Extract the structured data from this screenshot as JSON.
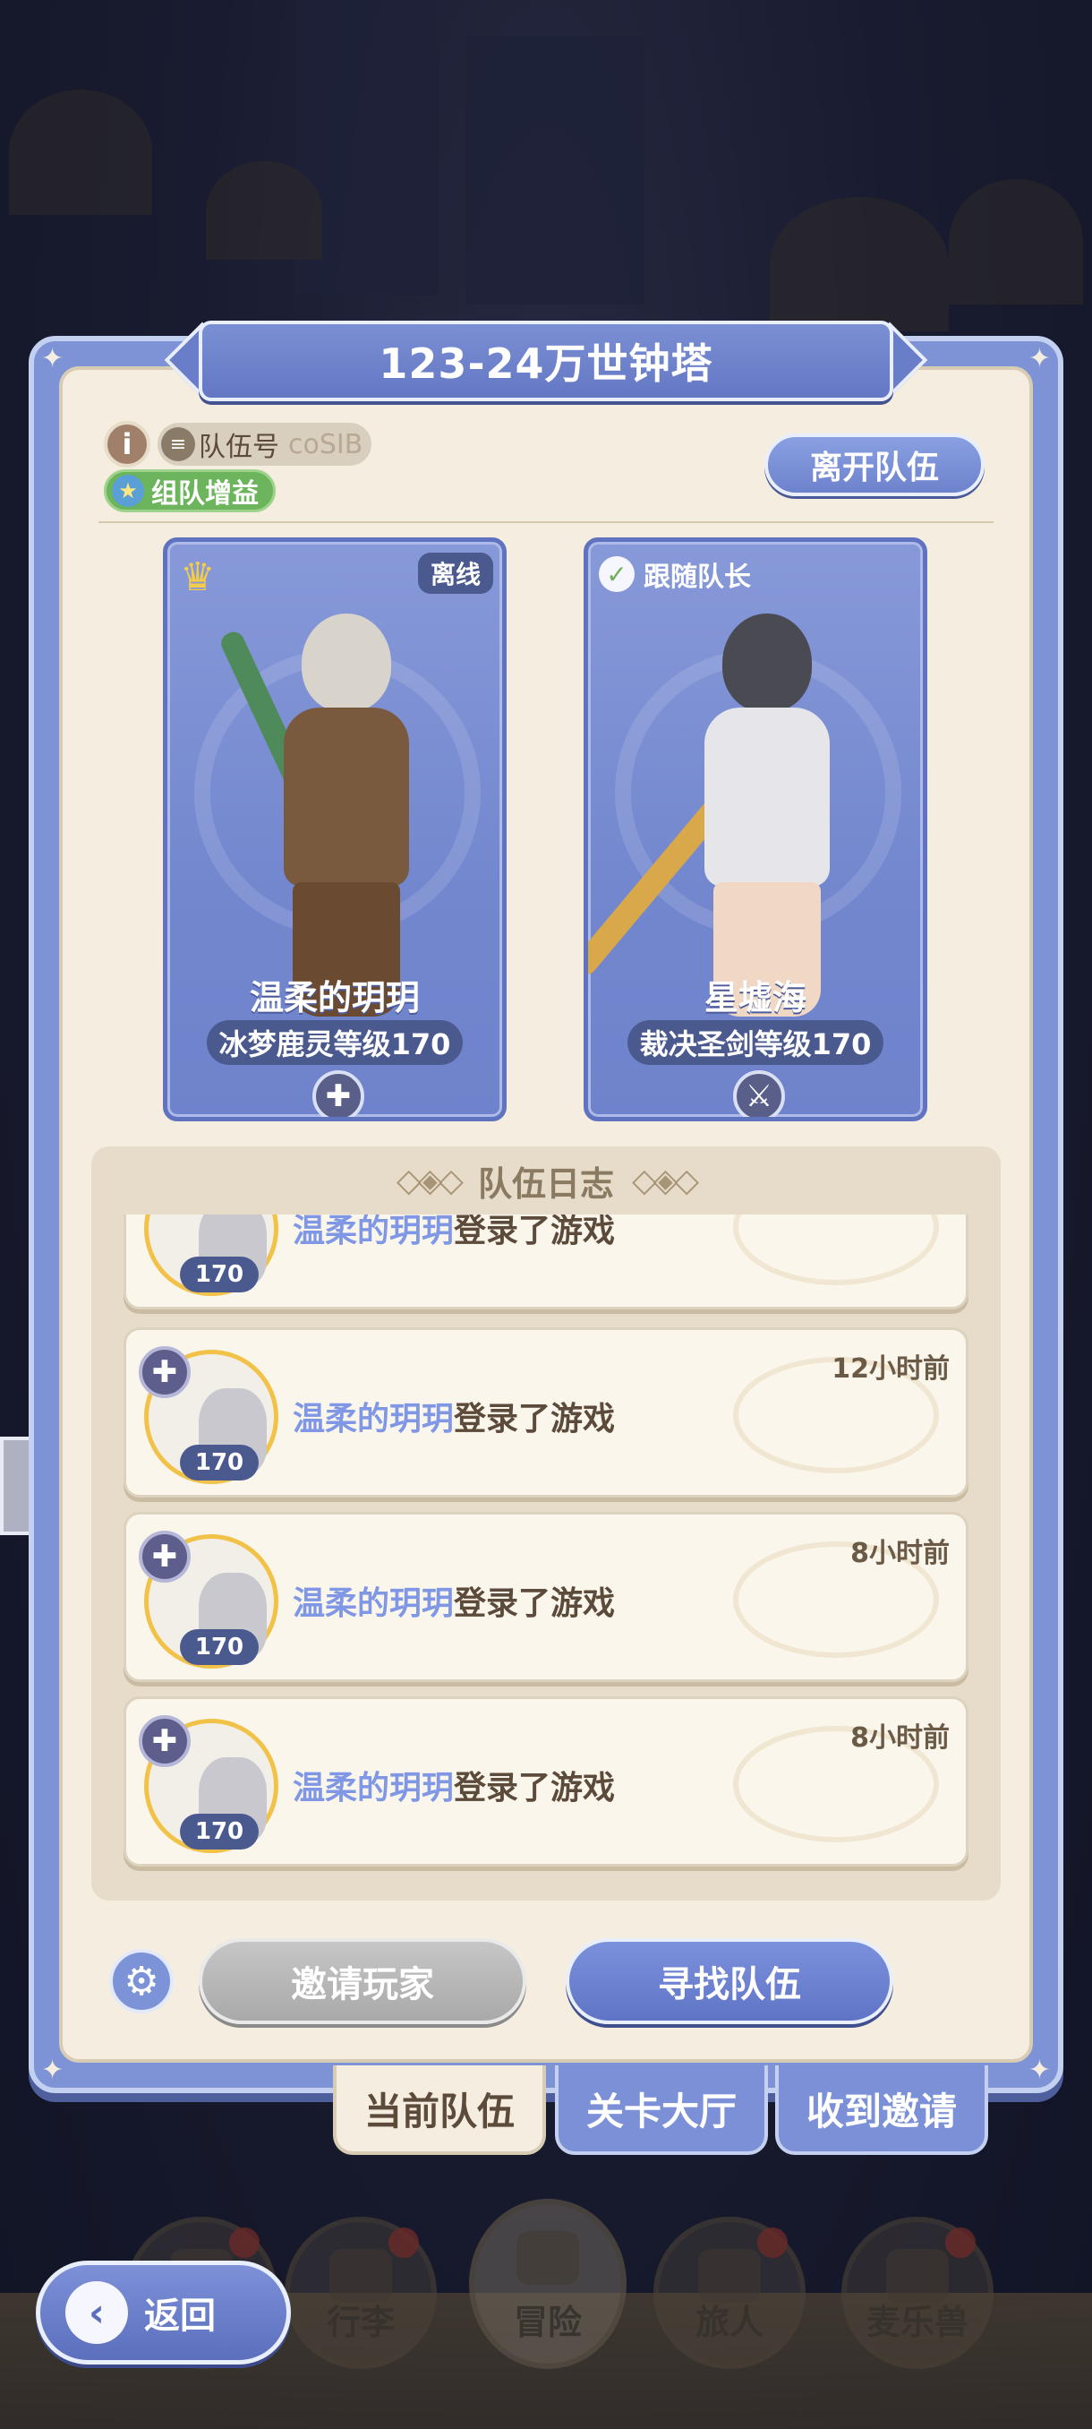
{
  "title": "123-24万世钟塔",
  "team_id": {
    "label": "队伍号",
    "value": "coSIB"
  },
  "buff_label": "组队增益",
  "leave_label": "离开队伍",
  "members": [
    {
      "name": "温柔的玥玥",
      "level_text": "冰梦鹿灵等级170",
      "status": "离线",
      "role_icon": "crown-icon",
      "class_icon": "cross-shield-icon"
    },
    {
      "name": "星墟海",
      "level_text": "裁决圣剑等级170",
      "status": "跟随队长",
      "class_icon": "sword-shield-icon"
    }
  ],
  "log_title": "队伍日志",
  "logs": [
    {
      "name": "温柔的玥玥",
      "action": "登录了游戏",
      "time": "",
      "level": "170"
    },
    {
      "name": "温柔的玥玥",
      "action": "登录了游戏",
      "time": "12小时前",
      "level": "170"
    },
    {
      "name": "温柔的玥玥",
      "action": "登录了游戏",
      "time": "8小时前",
      "level": "170"
    },
    {
      "name": "温柔的玥玥",
      "action": "登录了游戏",
      "time": "8小时前",
      "level": "170"
    }
  ],
  "invite_label": "邀请玩家",
  "find_label": "寻找队伍",
  "tabs": [
    {
      "label": "当前队伍",
      "active": true
    },
    {
      "label": "关卡大厅",
      "active": false
    },
    {
      "label": "收到邀请",
      "active": false
    }
  ],
  "back_label": "返回",
  "nav": [
    {
      "label": "行李"
    },
    {
      "label": "冒险"
    },
    {
      "label": "旅人"
    },
    {
      "label": "麦乐兽"
    }
  ],
  "colors": {
    "accent": "#7b8fd4",
    "name_link": "#7f97e4",
    "panel_bg": "#f4ede0"
  }
}
